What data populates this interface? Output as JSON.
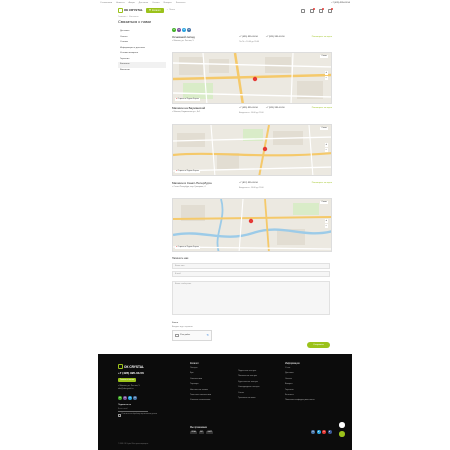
{
  "topbar": {
    "links": [
      "О компании",
      "Новости",
      "Акции",
      "Доставка",
      "Оплата",
      "Возврат",
      "Контакты"
    ],
    "phone": "+7 (495) 995-03-56"
  },
  "header": {
    "logo": "ОК CRYSTAL",
    "catalog_label": "Каталог",
    "search_label": "Поиск",
    "cart_counts": [
      "0",
      "0",
      "0"
    ]
  },
  "breadcrumbs": [
    "Главная",
    "Контакты"
  ],
  "page_title": "Связаться с нами",
  "sidebar": {
    "items": [
      {
        "label": "Доставка",
        "active": false
      },
      {
        "label": "Оплата",
        "active": false
      },
      {
        "label": "Отзывы",
        "active": false
      },
      {
        "label": "Информация о доставке",
        "active": false
      },
      {
        "label": "Условия возврата",
        "active": false
      },
      {
        "label": "Гарантия",
        "active": false
      },
      {
        "label": "Контакты",
        "active": true
      },
      {
        "label": "Вакансии",
        "active": false
      }
    ]
  },
  "stores": [
    {
      "name": "Основной склад",
      "address": "г. Москва, ул. Лесная, 5",
      "phones": [
        "+7 (495) 995-03-56",
        "+7 (925) 995-03-56"
      ],
      "hours": "Пн-Пт с 10:00 до 20:00",
      "link": "Посмотреть на карте"
    },
    {
      "name": "Магазин на Бауманской",
      "address": "г. Москва, Бауманская ул., 6с1",
      "phones": [
        "+7 (495) 995-03-56",
        "+7 (925) 995-03-56"
      ],
      "hours": "Ежедневно с 10:00 до 21:00",
      "link": "Посмотреть на карте"
    },
    {
      "name": "Магазин в Санкт-Петербурге",
      "address": "г. Санкт-Петербург, пер. Гривцова, 4",
      "phones": [
        "+7 (812) 995-03-56"
      ],
      "hours": "Ежедневно с 10:00 до 21:00",
      "link": "Посмотреть на карте"
    }
  ],
  "map": {
    "badge": "Открыть в Яндекс.Картах",
    "type_label": "Схема",
    "zoom_in": "+",
    "zoom_out": "−"
  },
  "form": {
    "title": "Напишите нам",
    "name_placeholder": "Ваше имя",
    "email_placeholder": "E-mail",
    "message_placeholder": "Ваше сообщение",
    "captcha_title": "Капча",
    "captcha_hint": "Введите код с картинки",
    "captcha_label": "Я не робот",
    "submit_label": "Отправить"
  },
  "footer": {
    "logo": "ОК CRYSTAL",
    "phone": "+7 (495) 995-03-56",
    "callback_label": "Заказать звонок",
    "address": "г. Москва, ул. Лесная, 5",
    "email": "info@okcrystal.ru",
    "subscribe_title": "Подписаться",
    "subscribe_placeholder": "Ваш e-mail",
    "consent": "Я согласен на обработку персональных данных",
    "col1_title": "Каталог",
    "col1_links": [
      "Люстры",
      "Бра",
      "Светильники",
      "Торшеры",
      "Настольные лампы",
      "Точечные светильники",
      "Уличные светильники"
    ],
    "col2_links": [
      "Подвесные люстры",
      "Потолочные люстры",
      "Хрустальные люстры",
      "Светодиодные люстры",
      "Споты",
      "Трековые системы"
    ],
    "col3_title": "Информация",
    "col3_links": [
      "О нас",
      "Доставка",
      "Оплата",
      "Возврат",
      "Гарантия",
      "Контакты",
      "Политика конфиденциальности"
    ],
    "apps_title": "Мы принимаем",
    "payments": [
      "VISA",
      "MC",
      "МИР"
    ],
    "copyright": "© 2024 OK Crystal. Все права защищены."
  },
  "colors": {
    "accent": "#9bc21b",
    "footer_bg": "#0c0c0c",
    "badge": "#e53935"
  }
}
